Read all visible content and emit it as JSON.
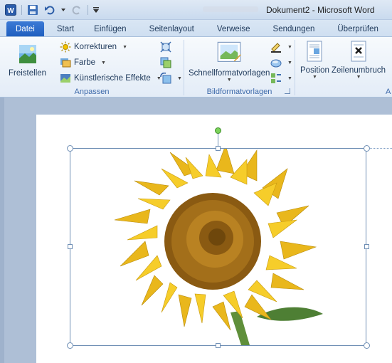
{
  "window": {
    "title": "Dokument2 - Microsoft Word",
    "app_icon": "W"
  },
  "quick_access": {
    "icons": [
      "word-icon",
      "save-icon",
      "undo-icon",
      "redo-icon",
      "customize-icon"
    ]
  },
  "tabs": [
    {
      "label": "Datei",
      "type": "file"
    },
    {
      "label": "Start"
    },
    {
      "label": "Einfügen"
    },
    {
      "label": "Seitenlayout"
    },
    {
      "label": "Verweise"
    },
    {
      "label": "Sendungen"
    },
    {
      "label": "Überprüfen"
    }
  ],
  "ribbon": {
    "adjust": {
      "freistellen": "Freistellen",
      "korrekturen": "Korrekturen",
      "farbe": "Farbe",
      "effekte": "Künstlerische Effekte",
      "label": "Anpassen"
    },
    "styles": {
      "schnellformat": "Schnellformatvorlagen",
      "label": "Bildformatvorlagen"
    },
    "arrange": {
      "position": "Position",
      "zeilenumbruch": "Zeilenumbruch",
      "label_partial": "A"
    }
  },
  "colors": {
    "file_tab": "#2a6bcb",
    "ribbon_bg": "#e3ecf7",
    "doc_bg": "#aebfd6"
  }
}
